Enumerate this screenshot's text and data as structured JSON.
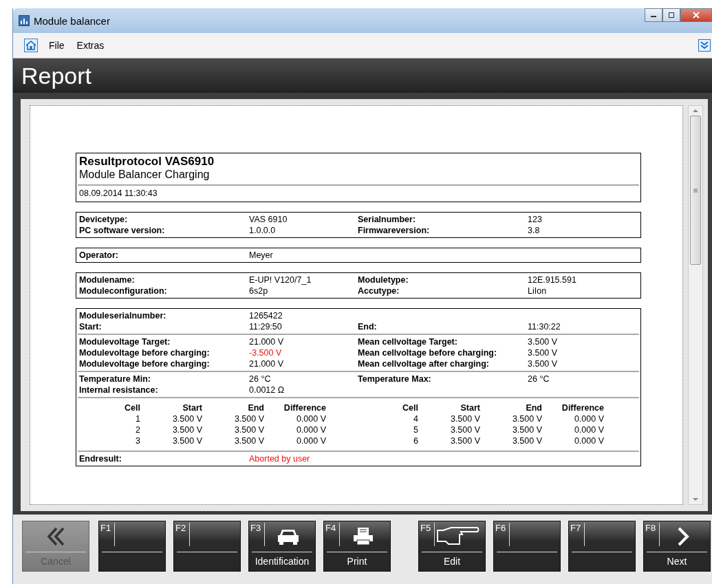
{
  "window": {
    "title": "Module balancer"
  },
  "menu": [
    "File",
    "Extras"
  ],
  "header": {
    "title": "Report"
  },
  "report": {
    "title": "Resultprotocol VAS6910",
    "subtitle": "Module Balancer Charging",
    "date": "08.09.2014 11:30:43",
    "blocks": [
      {
        "groups": [
          [
            {
              "label": "Devicetype:",
              "value": "VAS 6910",
              "label2": "Serialnumber:",
              "value2": "123"
            },
            {
              "label": "PC software version:",
              "value": "1.0.0.0",
              "label2": "Firmwareversion:",
              "value2": "3.8"
            }
          ]
        ]
      },
      {
        "groups": [
          [
            {
              "label": "Operator:",
              "value": "Meyer"
            }
          ]
        ]
      },
      {
        "groups": [
          [
            {
              "label": "Modulename:",
              "value": "E-UP! V120/7_1",
              "label2": "Moduletype:",
              "value2": "12E.915.591"
            },
            {
              "label": "Moduleconfiguration:",
              "value": "6s2p",
              "label2": "Accutype:",
              "value2": "LiIon"
            }
          ]
        ]
      },
      {
        "groups": [
          [
            {
              "label": "Moduleserialnumber:",
              "value": "1265422"
            },
            {
              "label": "Start:",
              "value": "11:29:50",
              "label2": "End:",
              "value2": "11:30:22"
            }
          ],
          [
            {
              "label": "Modulevoltage Target:",
              "value": "21.000 V",
              "label2": "Mean cellvoltage Target:",
              "value2": "3.500 V"
            },
            {
              "label": "Modulevoltage before charging:",
              "value": "-3.500 V",
              "alert": true,
              "label2": "Mean cellvoltage before charging:",
              "value2": "3.500 V"
            },
            {
              "label": "Modulevoltage before charging:",
              "value": "21.000 V",
              "label2": "Mean cellvoltage after charging:",
              "value2": "3.500 V"
            }
          ],
          [
            {
              "label": "Temperature Min:",
              "value": "26 °C",
              "label2": "Temperature Max:",
              "value2": "26 °C"
            },
            {
              "label": "Internal resistance:",
              "value": "0.0012 Ω"
            }
          ]
        ],
        "cells": [
          {
            "columns": [
              "Cell",
              "Start",
              "End",
              "Difference"
            ],
            "rows": [
              [
                "1",
                "3.500 V",
                "3.500 V",
                "0.000 V"
              ],
              [
                "2",
                "3.500 V",
                "3.500 V",
                "0.000 V"
              ],
              [
                "3",
                "3.500 V",
                "3.500 V",
                "0.000 V"
              ]
            ]
          },
          {
            "columns": [
              "Cell",
              "Start",
              "End",
              "Difference"
            ],
            "rows": [
              [
                "4",
                "3.500 V",
                "3.500 V",
                "0.000 V"
              ],
              [
                "5",
                "3.500 V",
                "3.500 V",
                "0.000 V"
              ],
              [
                "6",
                "3.500 V",
                "3.500 V",
                "0.000 V"
              ]
            ]
          }
        ],
        "result": {
          "label": "Endresult:",
          "value": "Aborted by user",
          "alert": true
        }
      }
    ]
  },
  "cancel": {
    "label": "Cancel",
    "disabled": true
  },
  "key_groups": [
    [
      {
        "key": "F1"
      },
      {
        "key": "F2"
      },
      {
        "key": "F3",
        "label": "Identification",
        "kind": "car"
      },
      {
        "key": "F4",
        "label": "Print",
        "kind": "printer"
      }
    ],
    [
      {
        "key": "F5",
        "label": "Edit",
        "kind": "hand"
      },
      {
        "key": "F6"
      },
      {
        "key": "F7"
      },
      {
        "key": "F8",
        "label": "Next",
        "kind": "chevron"
      }
    ]
  ]
}
